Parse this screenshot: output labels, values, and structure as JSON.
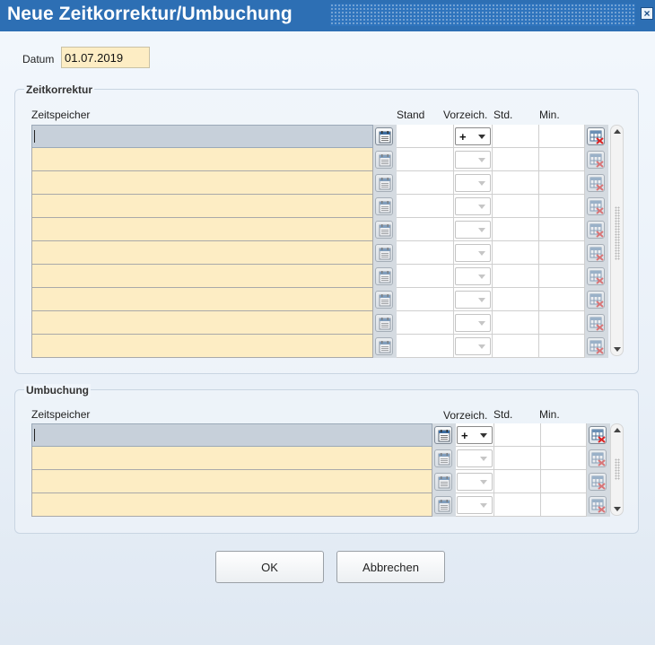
{
  "window": {
    "title": "Neue Zeitkorrektur/Umbuchung",
    "close_symbol": "×"
  },
  "datum": {
    "label": "Datum",
    "value": "01.07.2019"
  },
  "zeitkorrektur": {
    "title": "Zeitkorrektur",
    "columns": {
      "zeitspeicher": "Zeitspeicher",
      "stand": "Stand",
      "vorzeichen": "Vorzeich.",
      "std": "Std.",
      "min": "Min."
    },
    "rows": 10,
    "sign_value": "+"
  },
  "umbuchung": {
    "title": "Umbuchung",
    "columns": {
      "zeitspeicher": "Zeitspeicher",
      "vorzeichen": "Vorzeich.",
      "std": "Std.",
      "min": "Min."
    },
    "rows": 4,
    "sign_value": "+"
  },
  "buttons": {
    "ok": "OK",
    "cancel": "Abbrechen"
  },
  "colors": {
    "title_bar": "#2d6fb4",
    "input_fill": "#fdedc4",
    "active_row": "#c7d0da"
  },
  "icons": {
    "row_lookup": "calendar-list-icon",
    "row_delete": "table-delete-icon"
  }
}
